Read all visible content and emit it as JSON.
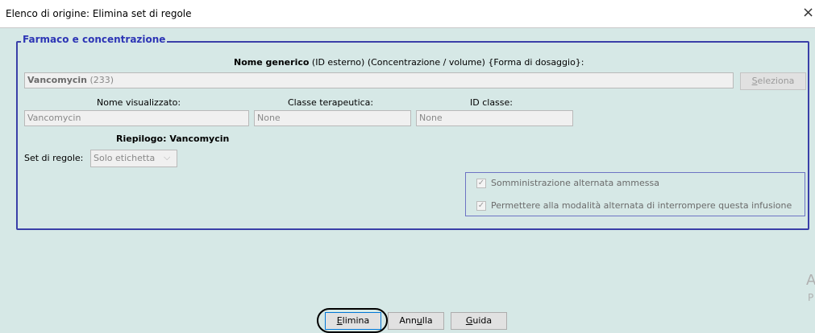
{
  "window": {
    "title": "Elenco di origine: Elimina set di regole",
    "close_glyph": "×"
  },
  "group": {
    "title": "Farmaco e concentrazione",
    "header_bold": "Nome generico",
    "header_rest": " (ID esterno) (Concentrazione / volume) {Forma di dosaggio}:",
    "drug_name": "Vancomycin",
    "drug_id": " (233)",
    "select_button": {
      "prefix": "",
      "mnemonic": "S",
      "rest": "eleziona"
    },
    "display_name_label": "Nome visualizzato:",
    "display_name_value": "Vancomycin",
    "therapeutic_class_label": "Classe terapeutica:",
    "therapeutic_class_value": "None",
    "class_id_label": "ID classe:",
    "class_id_value": "None",
    "summary": "Riepilogo: Vancomycin",
    "rule_set_label": "Set di regole:",
    "rule_set_value": "Solo etichetta",
    "options": [
      {
        "label": "Somministrazione alternata ammessa",
        "checked": true
      },
      {
        "label": "Permettere alla modalità alternata di interrompere questa infusione",
        "checked": true
      }
    ]
  },
  "buttons": {
    "delete": {
      "prefix": "",
      "mnemonic": "E",
      "rest": "limina"
    },
    "cancel": {
      "prefix": "Ann",
      "mnemonic": "u",
      "rest": "lla"
    },
    "help": {
      "prefix": "",
      "mnemonic": "G",
      "rest": "uida"
    }
  },
  "side_text": {
    "line1": "A",
    "line2": "P"
  }
}
